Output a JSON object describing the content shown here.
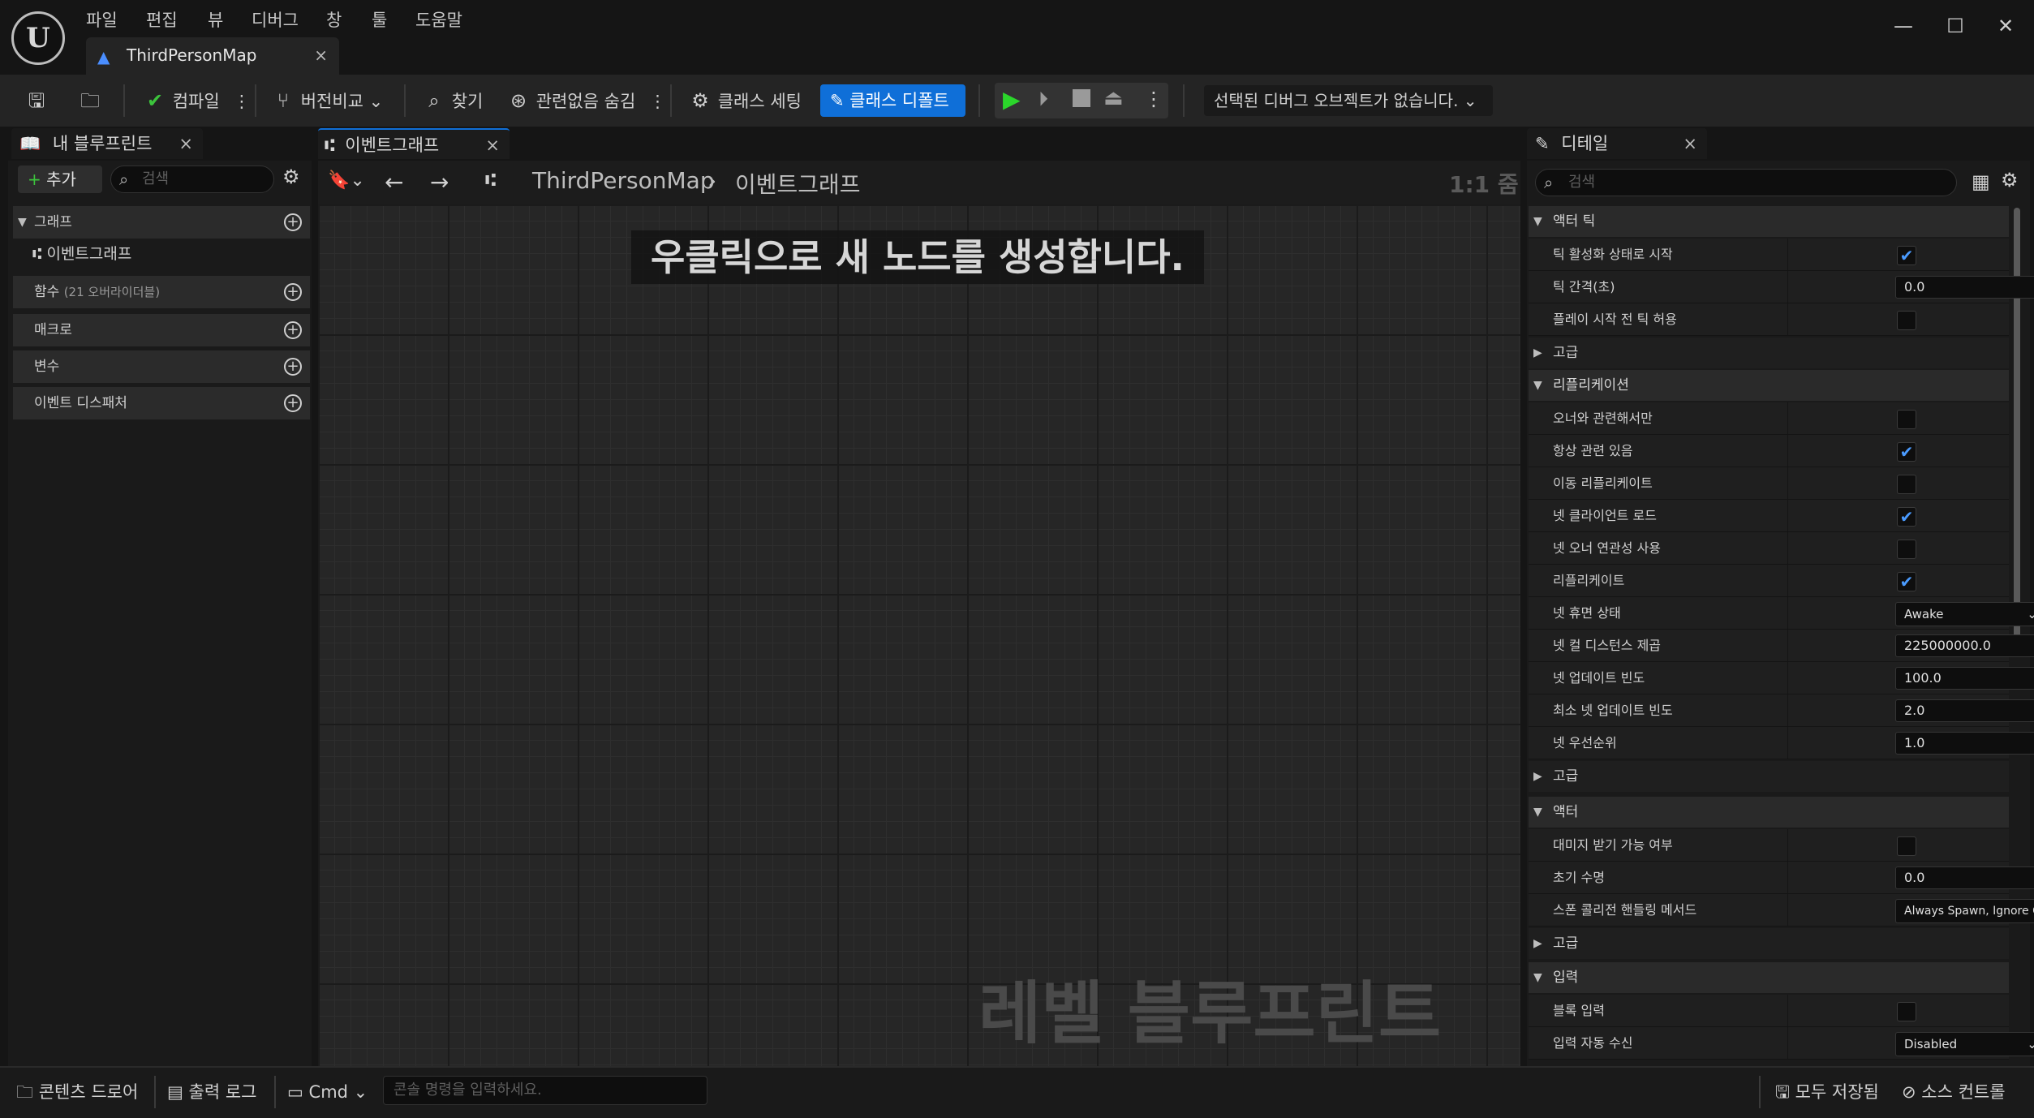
{
  "app": {
    "logo_glyph": "U",
    "menu": [
      "파일",
      "편집",
      "뷰",
      "디버그",
      "창",
      "툴",
      "도움말"
    ],
    "document_tab": "ThirdPersonMap",
    "close_glyph": "×"
  },
  "window_buttons": {
    "minimize": "—",
    "maximize": "☐",
    "close": "✕"
  },
  "toolbar": {
    "compile": "컴파일",
    "diff": "버전비교",
    "find": "찾기",
    "hide_unrelated": "관련없음 숨김",
    "class_settings": "클래스 세팅",
    "class_defaults": "클래스 디폴트",
    "debug_object": "선택된 디버그 오브젝트가 없습니다."
  },
  "my_blueprint": {
    "tab_title": "내 블루프린트",
    "add_button": "추가",
    "search_placeholder": "검색",
    "graph_section": "그래프",
    "event_graph_item": "이벤트그래프",
    "functions_label": "함수",
    "functions_overrides": "(21 오버라이더블)",
    "macros_label": "매크로",
    "variables_label": "변수",
    "dispatchers_label": "이벤트 디스패처"
  },
  "graph": {
    "tab_title": "이벤트그래프",
    "breadcrumb_root": "ThirdPersonMap",
    "breadcrumb_current": "이벤트그래프",
    "zoom_label": "1:1 줌",
    "hint": "우클릭으로 새 노드를 생성합니다.",
    "watermark": "레벨 블루프린트"
  },
  "details": {
    "tab_title": "디테일",
    "search_placeholder": "검색",
    "sections": {
      "actor_tick": "액터 틱",
      "advanced": "고급",
      "replication": "리플리케이션",
      "actor": "액터",
      "input": "입력"
    },
    "props": {
      "start_with_tick": {
        "label": "틱 활성화 상태로 시작",
        "checked": true
      },
      "tick_interval": {
        "label": "틱 간격(초)",
        "value": "0.0"
      },
      "tick_before_begin": {
        "label": "플레이 시작 전 틱 허용",
        "checked": false
      },
      "only_relevant_to_owner": {
        "label": "오너와 관련해서만",
        "checked": false
      },
      "always_relevant": {
        "label": "항상 관련 있음",
        "checked": true
      },
      "replicate_movement": {
        "label": "이동 리플리케이트",
        "checked": false
      },
      "net_load_on_client": {
        "label": "넷 클라이언트 로드",
        "checked": true
      },
      "net_use_owner_relevancy": {
        "label": "넷 오너 연관성 사용",
        "checked": false
      },
      "replicates": {
        "label": "리플리케이트",
        "checked": true
      },
      "net_dormancy": {
        "label": "넷 휴면 상태",
        "value": "Awake"
      },
      "net_cull_distance": {
        "label": "넷 컬 디스턴스 제곱",
        "value": "225000000.0"
      },
      "net_update_freq": {
        "label": "넷 업데이트 빈도",
        "value": "100.0"
      },
      "min_net_update_freq": {
        "label": "최소 넷 업데이트 빈도",
        "value": "2.0"
      },
      "net_priority": {
        "label": "넷 우선순위",
        "value": "1.0"
      },
      "can_be_damaged": {
        "label": "대미지 받기 가능 여부",
        "checked": false
      },
      "initial_life_span": {
        "label": "초기 수명",
        "value": "0.0"
      },
      "spawn_collision": {
        "label": "스폰 콜리전 핸들링 메서드",
        "value": "Always Spawn, Ignore Collisions"
      },
      "block_input": {
        "label": "블록 입력",
        "checked": false
      },
      "auto_receive_input": {
        "label": "입력 자동 수신",
        "value": "Disabled"
      }
    }
  },
  "statusbar": {
    "content_drawer": "콘텐츠 드로어",
    "output_log": "출력 로그",
    "cmd": "Cmd",
    "console_placeholder": "콘솔 명령을 입력하세요.",
    "save_all": "모두 저장됨",
    "source_control": "소스 컨트롤"
  },
  "colors": {
    "accent": "#0f6fd8",
    "play": "#2bd62b",
    "check": "#4a9bff"
  }
}
